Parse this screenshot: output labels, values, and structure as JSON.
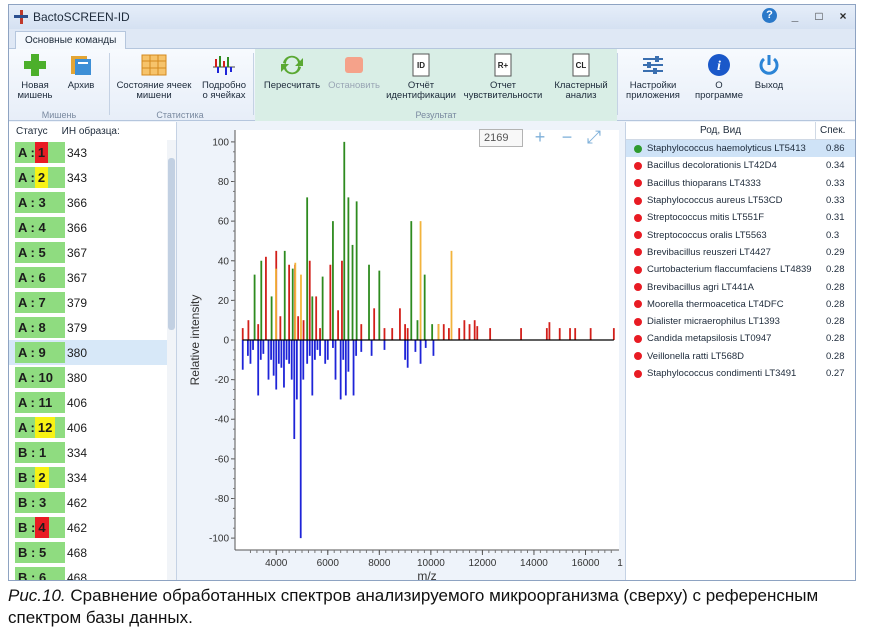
{
  "window": {
    "title": "BactoSCREEN-ID"
  },
  "titlebar": {
    "help": "?",
    "minimize": "_",
    "maximize": "□",
    "close": "×"
  },
  "tabs": [
    {
      "label": "Основные команды"
    }
  ],
  "ribbon": {
    "buttons": {
      "new_target": "Новая мишень",
      "archive": "Архив",
      "cells_state": "Состояние ячеек мишени",
      "details": "Подробно о ячейках",
      "recalc": "Пересчитать",
      "stop": "Остановить",
      "id_report": "Отчёт идентификации",
      "sens_report": "Отчет чувствительности",
      "cluster": "Кластерный анализ",
      "settings": "Настройки приложения",
      "about": "О программе",
      "exit": "Выход"
    },
    "icon_text": {
      "id_report": "ID",
      "sens_report": "R+",
      "cluster": "CL",
      "about": "i"
    },
    "groups": {
      "target": "Мишень",
      "stats": "Статистика",
      "result": "Результат"
    }
  },
  "left_panel": {
    "headers": {
      "status": "Статус",
      "sample_id": "ИН образца:"
    },
    "samples": [
      {
        "pre": "A : ",
        "mark": "1",
        "mark_color": "red",
        "id": "343"
      },
      {
        "pre": "A : ",
        "mark": "2",
        "mark_color": "yellow",
        "id": "343"
      },
      {
        "pre": "A : 3",
        "mark": "",
        "mark_color": "",
        "id": "366"
      },
      {
        "pre": "A : 4",
        "mark": "",
        "mark_color": "",
        "id": "366"
      },
      {
        "pre": "A : 5",
        "mark": "",
        "mark_color": "",
        "id": "367"
      },
      {
        "pre": "A : 6",
        "mark": "",
        "mark_color": "",
        "id": "367"
      },
      {
        "pre": "A : 7",
        "mark": "",
        "mark_color": "",
        "id": "379"
      },
      {
        "pre": "A : 8",
        "mark": "",
        "mark_color": "",
        "id": "379"
      },
      {
        "pre": "A : 9",
        "mark": "",
        "mark_color": "",
        "id": "380",
        "selected": true
      },
      {
        "pre": "A : 10",
        "mark": "",
        "mark_color": "",
        "id": "380"
      },
      {
        "pre": "A : 11",
        "mark": "",
        "mark_color": "",
        "id": "406"
      },
      {
        "pre": "A : ",
        "mark": "12",
        "mark_color": "yellow",
        "id": "406"
      },
      {
        "pre": "B : 1",
        "mark": "",
        "mark_color": "",
        "id": "334"
      },
      {
        "pre": "B : ",
        "mark": "2",
        "mark_color": "yellow",
        "id": "334"
      },
      {
        "pre": "B : 3",
        "mark": "",
        "mark_color": "",
        "id": "462"
      },
      {
        "pre": "B : ",
        "mark": "4",
        "mark_color": "red",
        "id": "462"
      },
      {
        "pre": "B : 5",
        "mark": "",
        "mark_color": "",
        "id": "468"
      },
      {
        "pre": "B : 6",
        "mark": "",
        "mark_color": "",
        "id": "468"
      }
    ]
  },
  "zoom": {
    "value": "2169",
    "zoom_in": "+",
    "zoom_out": "−",
    "fit": "⤢"
  },
  "chart_data": {
    "type": "bar",
    "xlabel": "m/z",
    "ylabel": "Relative intensity",
    "xlim": [
      2400,
      17300
    ],
    "ylim": [
      -106,
      106
    ],
    "xticks": [
      4000,
      6000,
      8000,
      10000,
      12000,
      14000,
      16000
    ],
    "yticks": [
      100,
      80,
      60,
      40,
      20,
      0,
      -20,
      -40,
      -60,
      -80,
      -100
    ],
    "tick_cut_label": "1",
    "colors": {
      "matched": "#2e8b1f",
      "sample": "#d21f1a",
      "partial": "#f2b43c",
      "reference": "#1e24d8",
      "baseline": "#000000"
    },
    "series": [
      {
        "name": "",
        "color_key": "matched",
        "x": [
          3160,
          3420,
          3820,
          4330,
          4640,
          5200,
          5400,
          5800,
          6200,
          6640,
          6800,
          6960,
          7120,
          7600,
          8000,
          9240,
          9480,
          9760,
          10050
        ],
        "values": [
          33,
          40,
          22,
          45,
          36,
          72,
          22,
          32,
          60,
          100,
          72,
          48,
          70,
          38,
          35,
          60,
          10,
          33,
          8
        ]
      },
      {
        "name": "",
        "color_key": "sample",
        "x": [
          2700,
          2920,
          3300,
          3600,
          4000,
          4160,
          4500,
          4730,
          4850,
          5060,
          5300,
          5550,
          5700,
          6100,
          6400,
          6550,
          7300,
          7800,
          8200,
          8500,
          8800,
          9000,
          9100,
          10300,
          10500,
          10700,
          11100,
          11300,
          11500,
          11700,
          11800,
          12300,
          13500,
          14500,
          14600,
          15000,
          15400,
          15600,
          16200,
          17100
        ],
        "values": [
          6,
          10,
          8,
          42,
          45,
          12,
          38,
          38,
          12,
          10,
          40,
          22,
          6,
          38,
          15,
          40,
          8,
          16,
          6,
          6,
          16,
          8,
          6,
          8,
          8,
          6,
          6,
          10,
          8,
          10,
          7,
          6,
          6,
          6,
          9,
          6,
          6,
          6,
          6,
          6
        ]
      },
      {
        "name": "",
        "color_key": "partial",
        "x": [
          3990,
          4740,
          4960,
          9600,
          10300,
          10800
        ],
        "values": [
          36,
          39,
          33,
          60,
          8,
          45
        ]
      },
      {
        "name": "",
        "color_key": "reference",
        "x": [
          2700,
          2900,
          3000,
          3100,
          3300,
          3400,
          3500,
          3700,
          3800,
          3900,
          4000,
          4100,
          4200,
          4300,
          4400,
          4500,
          4600,
          4700,
          4800,
          4950,
          5050,
          5200,
          5300,
          5400,
          5500,
          5600,
          5700,
          5900,
          6000,
          6200,
          6300,
          6500,
          6600,
          6700,
          6800,
          7000,
          7100,
          7300,
          7700,
          8200,
          9000,
          9100,
          9400,
          9600,
          9800,
          10100
        ],
        "values": [
          -15,
          -8,
          -12,
          -5,
          -28,
          -10,
          -7,
          -20,
          -10,
          -18,
          -25,
          -12,
          -14,
          -24,
          -10,
          -12,
          -20,
          -50,
          -30,
          -100,
          -20,
          -12,
          -8,
          -28,
          -10,
          -5,
          -8,
          -12,
          -10,
          -4,
          -20,
          -30,
          -10,
          -28,
          -16,
          -28,
          -8,
          -6,
          -8,
          -5,
          -10,
          -14,
          -6,
          -12,
          -4,
          -8
        ]
      }
    ]
  },
  "right_panel": {
    "headers": {
      "genus_species": "Род, Вид",
      "score": "Спек."
    },
    "results": [
      {
        "name": "Staphylococcus haemolyticus LT5413",
        "score": "0.86",
        "dot": "green"
      },
      {
        "name": "Bacillus decolorationis LT42D4",
        "score": "0.34",
        "dot": "red"
      },
      {
        "name": "Bacillus thioparans LT4333",
        "score": "0.33",
        "dot": "red"
      },
      {
        "name": "Staphylococcus aureus LT53CD",
        "score": "0.33",
        "dot": "red"
      },
      {
        "name": "Streptococcus mitis LT551F",
        "score": "0.31",
        "dot": "red"
      },
      {
        "name": "Streptococcus oralis LT5563",
        "score": "0.3",
        "dot": "red"
      },
      {
        "name": "Brevibacillus reuszeri LT4427",
        "score": "0.29",
        "dot": "red"
      },
      {
        "name": "Curtobacterium flaccumfaciens LT4839",
        "score": "0.28",
        "dot": "red"
      },
      {
        "name": "Brevibacillus agri LT441A",
        "score": "0.28",
        "dot": "red"
      },
      {
        "name": "Moorella thermoacetica LT4DFC",
        "score": "0.28",
        "dot": "red"
      },
      {
        "name": "Dialister micraerophilus LT1393",
        "score": "0.28",
        "dot": "red"
      },
      {
        "name": "Candida metapsilosis LT0947",
        "score": "0.28",
        "dot": "red"
      },
      {
        "name": "Veillonella ratti LT568D",
        "score": "0.28",
        "dot": "red"
      },
      {
        "name": "Staphylococcus condimenti LT3491",
        "score": "0.27",
        "dot": "red"
      }
    ]
  },
  "caption": {
    "figure": "Рис.10.",
    "text": " Сравнение обработанных спектров анализируемого микроорганизма (сверху) с референсным спектром базы данных."
  }
}
